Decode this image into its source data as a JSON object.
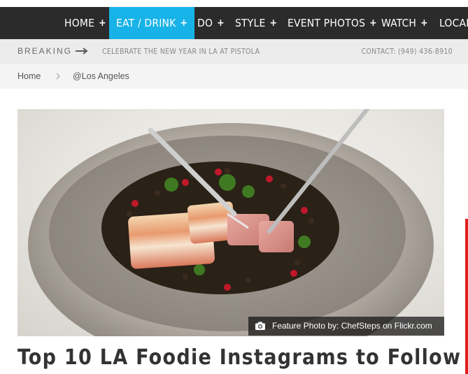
{
  "nav": {
    "items": [
      {
        "label": "HOME",
        "plus": "+"
      },
      {
        "label": "EAT / DRINK",
        "plus": "+"
      },
      {
        "label": "DO",
        "plus": "+"
      },
      {
        "label": "STYLE",
        "plus": "+"
      },
      {
        "label": "EVENT PHOTOS",
        "plus": "+"
      },
      {
        "label": "WATCH",
        "plus": "+"
      },
      {
        "label": "LOCAL",
        "plus": ""
      }
    ],
    "active_index": 1,
    "active_color": "#17b3e8",
    "background": "#2b2b2b"
  },
  "breaking": {
    "label": "BREAKING",
    "headline": "CELEBRATE THE NEW YEAR IN LA AT PISTOLA",
    "contact": "CONTACT: (949) 436-8910"
  },
  "breadcrumb": {
    "home": "Home",
    "current": "@Los Angeles"
  },
  "feature": {
    "caption": "Feature Photo by: ChefSteps on Flickr.com",
    "camera_icon": "camera-icon"
  },
  "article": {
    "title": "Top 10 LA Foodie Instagrams to Follow"
  }
}
